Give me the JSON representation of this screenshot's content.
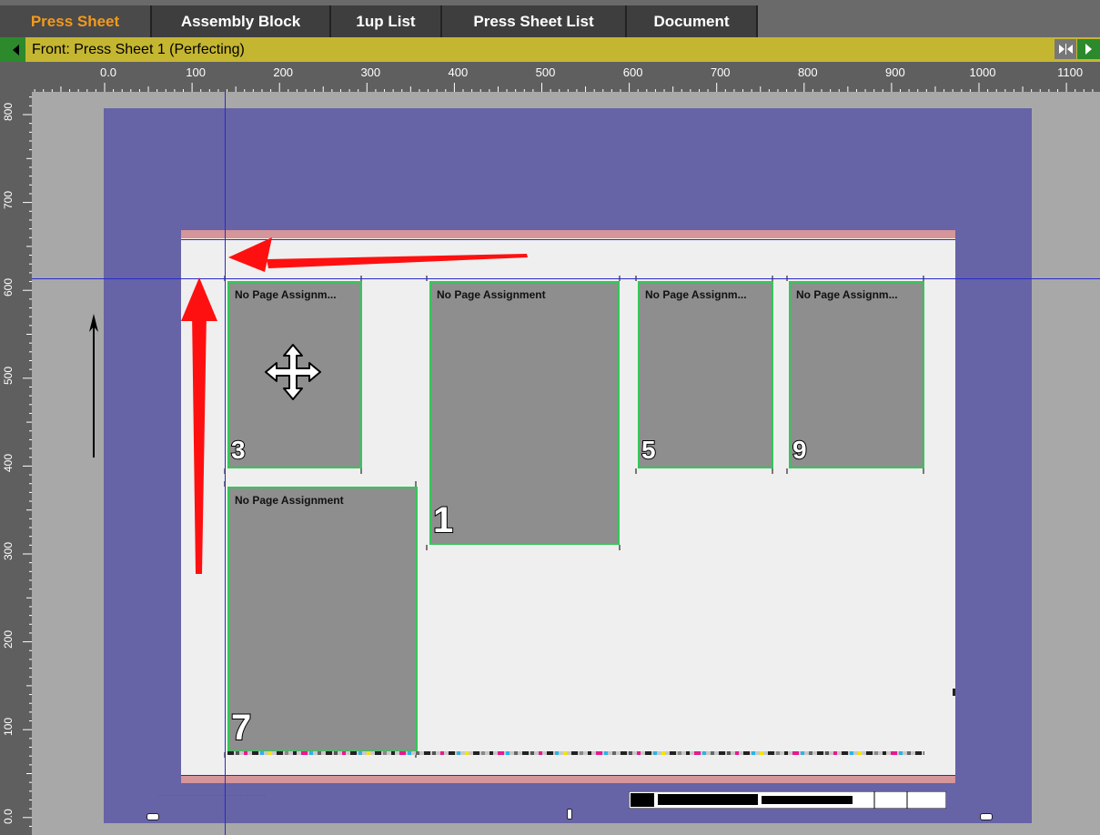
{
  "tabs": [
    {
      "label": "Press Sheet",
      "active": true
    },
    {
      "label": "Assembly Block",
      "active": false
    },
    {
      "label": "1up List",
      "active": false
    },
    {
      "label": "Press Sheet List",
      "active": false
    },
    {
      "label": "Document",
      "active": false
    }
  ],
  "sheet_header": {
    "label": "Front:  Press Sheet 1 (Perfecting)"
  },
  "ruler": {
    "h_labels": [
      "0.0",
      "100",
      "200",
      "300",
      "400",
      "500",
      "600",
      "700",
      "800",
      "900",
      "1000",
      "1100"
    ],
    "v_labels": [
      "800",
      "700",
      "600",
      "500",
      "400",
      "300",
      "200",
      "100",
      "0.0"
    ]
  },
  "pages": [
    {
      "label": "No Page Assignm...",
      "number": "3"
    },
    {
      "label": "No Page Assignment",
      "number": "1"
    },
    {
      "label": "No Page Assignm...",
      "number": "5"
    },
    {
      "label": "No Page Assignm...",
      "number": "9"
    },
    {
      "label": "No Page Assignment",
      "number": "7"
    }
  ],
  "colors": {
    "accent_tab": "#f39a1c",
    "sheet": "#6663a6",
    "page_border": "#34c759",
    "guide": "#2a2acc",
    "arrow": "#ff1010"
  },
  "icons": [
    "move-cursor-icon",
    "grain-direction-arrow-icon",
    "annotation-arrow-icon"
  ]
}
